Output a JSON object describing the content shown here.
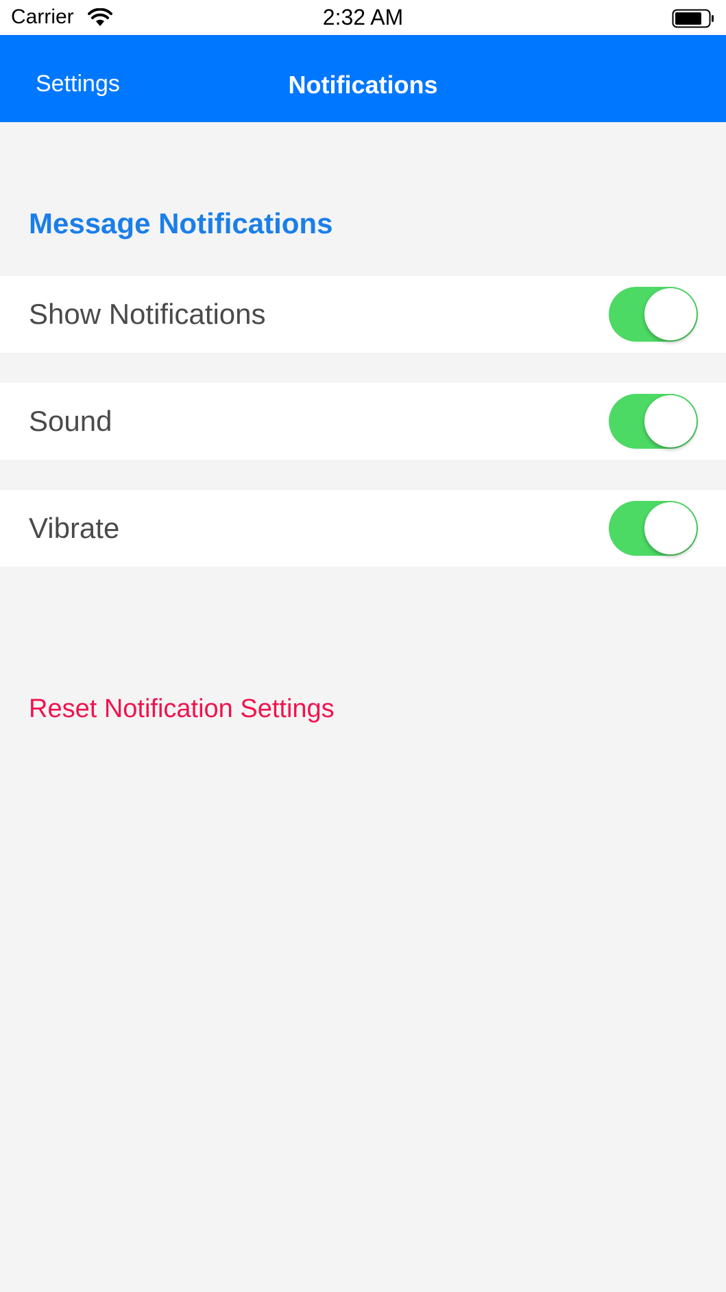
{
  "status_bar": {
    "carrier": "Carrier",
    "time": "2:32 AM",
    "wifi_icon": "wifi-icon",
    "battery_icon": "battery-icon"
  },
  "nav": {
    "back_label": "Settings",
    "title": "Notifications",
    "background_color": "#0077ff"
  },
  "section": {
    "header": "Message Notifications",
    "header_color": "#1a7ee8"
  },
  "rows": [
    {
      "label": "Show Notifications",
      "enabled": true
    },
    {
      "label": "Sound",
      "enabled": true
    },
    {
      "label": "Vibrate",
      "enabled": true
    }
  ],
  "toggle_on_color": "#4cd964",
  "reset": {
    "label": "Reset Notification Settings",
    "color": "#f0134e"
  }
}
